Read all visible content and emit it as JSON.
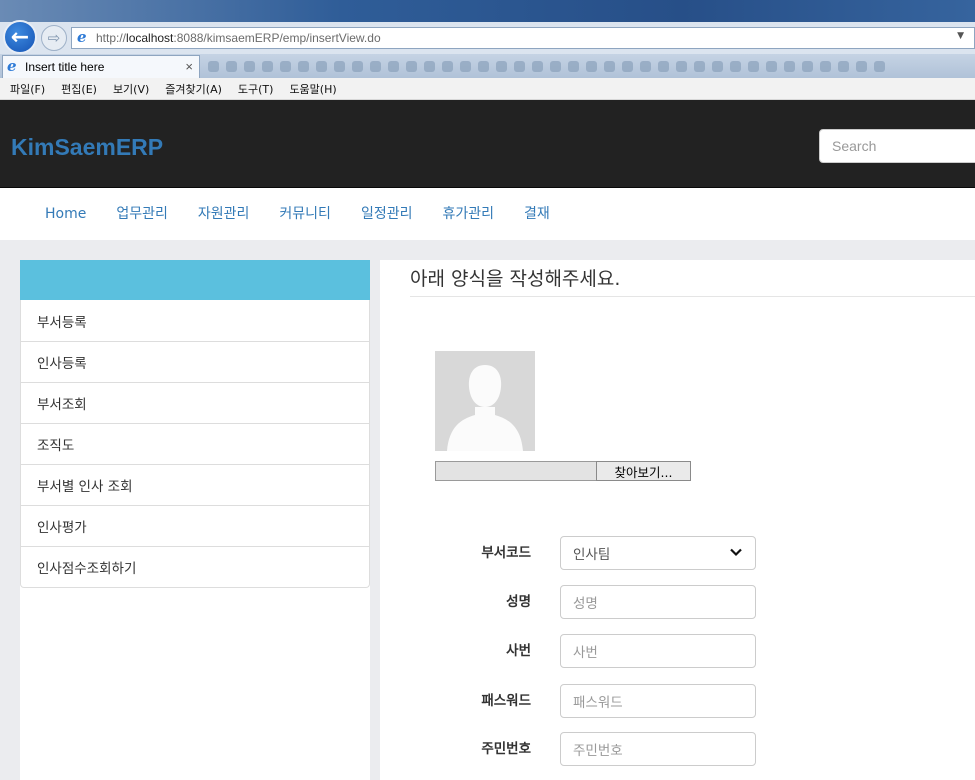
{
  "browser": {
    "url_prefix": "http://",
    "url_host": "localhost",
    "url_rest": ":8088/kimsaemERP/emp/insertView.do",
    "tab_title": "Insert title here",
    "tab_close": "×",
    "menu": [
      "파일(F)",
      "편집(E)",
      "보기(V)",
      "즐겨찾기(A)",
      "도구(T)",
      "도움말(H)"
    ]
  },
  "header": {
    "brand": "KimSaemERP",
    "search_placeholder": "Search"
  },
  "nav": {
    "items": [
      "Home",
      "업무관리",
      "자원관리",
      "커뮤니티",
      "일정관리",
      "휴가관리",
      "결재"
    ]
  },
  "sidebar": {
    "items": [
      "부서등록",
      "인사등록",
      "부서조회",
      "조직도",
      "부서별 인사 조회",
      "인사평가",
      "인사점수조회하기"
    ]
  },
  "form": {
    "title": "아래 양식을 작성해주세요.",
    "browse_button": "찾아보기...",
    "dept_label": "부서코드",
    "dept_value": "인사팀",
    "name_label": "성명",
    "name_placeholder": "성명",
    "empno_label": "사번",
    "empno_placeholder": "사번",
    "password_label": "패스워드",
    "password_placeholder": "패스워드",
    "ssn_label": "주민번호",
    "ssn_placeholder": "주민번호"
  },
  "colors": {
    "brand": "#337ab7",
    "header_bg": "#222222",
    "sidebar_head": "#5bc0de"
  }
}
